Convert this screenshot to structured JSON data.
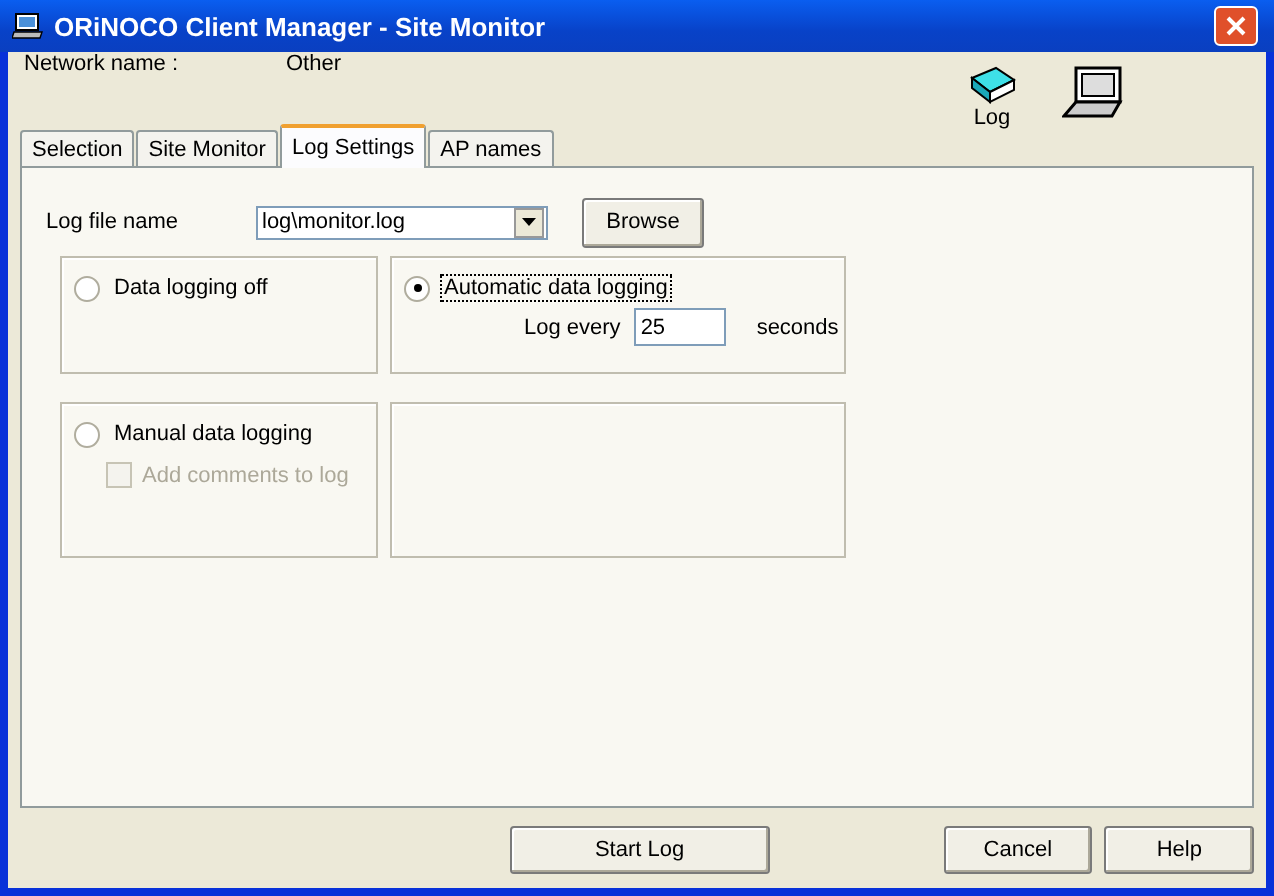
{
  "window": {
    "title": "ORiNOCO Client Manager - Site Monitor"
  },
  "network": {
    "label": "Network name :",
    "value": "Other"
  },
  "toolbar": [
    {
      "kind": "book",
      "label": "Log"
    },
    {
      "kind": "laptop"
    }
  ],
  "tabs": [
    {
      "label": "Selection",
      "selected": false
    },
    {
      "label": "Site Monitor",
      "selected": false
    },
    {
      "label": "Log Settings",
      "selected": true
    },
    {
      "label": "AP names",
      "selected": false
    }
  ],
  "log_file": {
    "label": "Log file name",
    "value": "log\\monitor.log",
    "button": {
      "label": "Browse"
    }
  },
  "modes": [
    {
      "label": "Data logging off",
      "selected": false,
      "focused": false
    },
    {
      "label": "Automatic data logging",
      "selected": true,
      "focused": true,
      "interval": {
        "label": "Log every",
        "value": "25",
        "unit": "seconds"
      }
    },
    {
      "label": "Manual data logging",
      "selected": false,
      "focused": false,
      "option": {
        "label": "Add comments to log",
        "checked": false,
        "disabled": true
      }
    }
  ],
  "buttons": [
    {
      "kind": "start",
      "label": "Start Log"
    },
    {
      "kind": "cancel",
      "label": "Cancel"
    },
    {
      "kind": "help",
      "label": "Help"
    }
  ]
}
